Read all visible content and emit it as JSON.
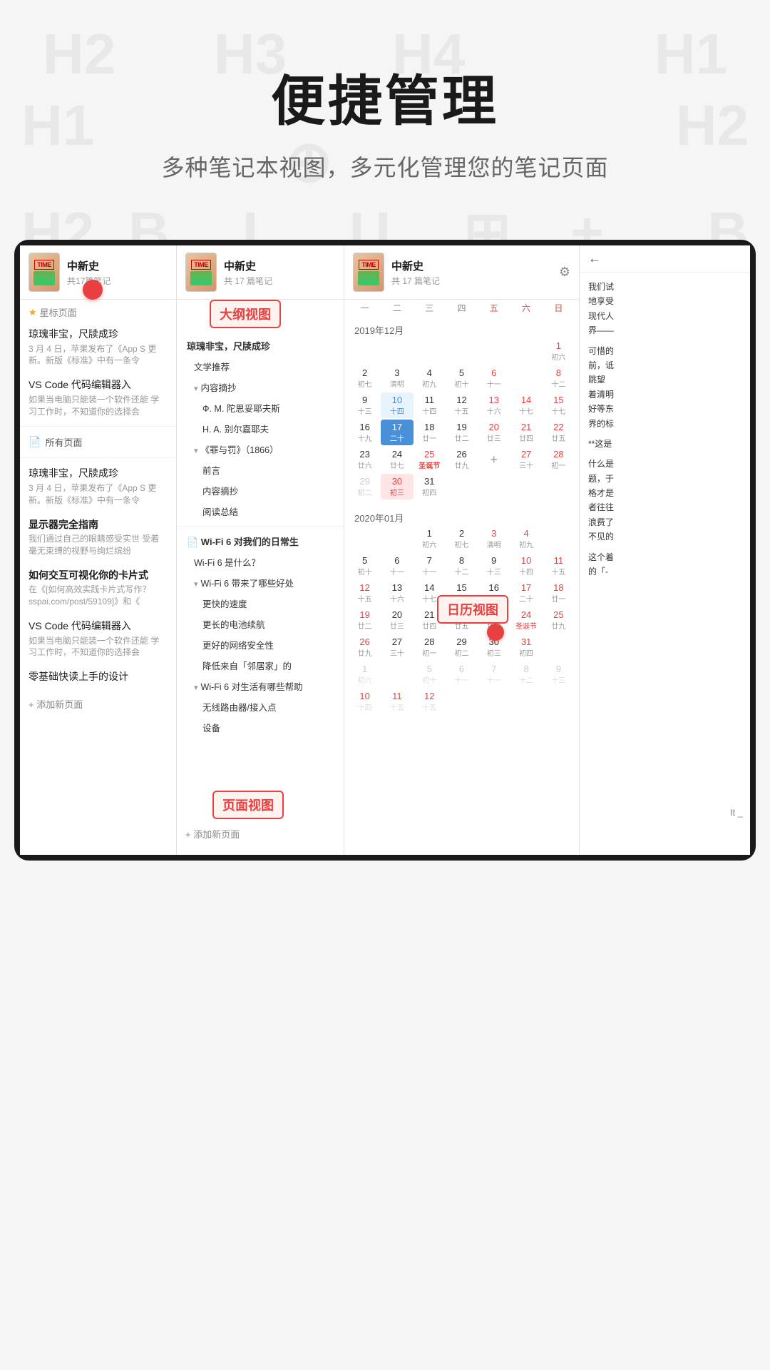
{
  "header": {
    "title": "便捷管理",
    "subtitle": "多种笔记本视图，多元化管理您的笔记页面"
  },
  "notebook": {
    "name": "中新史",
    "count": "共 17 篇笔记",
    "count2": "共17篇笔记",
    "count3": "共 17 篇笔记"
  },
  "left_panel": {
    "starred_label": "星标页面",
    "items": [
      {
        "title": "琼瑰非宝，尺牍成珍",
        "preview": "3 月 4 日，苹果发布了《App S 更新。新版《标准》中有一条令"
      },
      {
        "title": "VS Code 代码编辑器入",
        "preview": "如果当电脑只能装一个软件还能 学习工作时，不知道你的选择会"
      }
    ],
    "all_pages": "所有页面",
    "items2": [
      {
        "title": "琼瑰非宝，尺牍成珍",
        "preview": "3 月 4 日，苹果发布了《App S 更新。新版《标准》中有一条令"
      },
      {
        "title": "显示器完全指南",
        "preview": "我们通过自己的眼睛感受实世 受着毫无束缚的视野与绚烂缤纷"
      },
      {
        "title": "如何交互可视化你的卡片式",
        "preview": "在《[如何高效实践卡片式写作？ sspai.com/post/59109]》和《"
      },
      {
        "title": "VS Code 代码编辑器入",
        "preview": "如果当电脑只能装一个软件还能 学习工作时，不知道你的选择会"
      },
      {
        "title": "零基础快读上手的设计"
      }
    ],
    "add_page": "+ 添加新页面"
  },
  "middle_panel": {
    "label": "大纲视图",
    "starred_item": "琼瑰非宝，尺牍成珍",
    "items": [
      "文学推荐",
      "前言",
      "内容摘抄",
      "Ф. М. 陀思妥耶夫斯",
      "H. A. 别尔嘉耶夫",
      "《罪与罚》（1866）",
      "前言",
      "内容摘抄",
      "阅读总结"
    ],
    "second_item": "Wi-Fi 6 对我们的日常生",
    "wifi_items": [
      "Wi-Fi 6 是什么？",
      "Wi-Fi 6 带来了哪些好处",
      "更快的速度",
      "更长的电池续航",
      "更好的网络安全性",
      "降低来自「邻居家」的",
      "Wi-Fi 6 对生活有哪些帮助",
      "无线路由器/接入点",
      "设备"
    ],
    "add_page": "+ 添加新页面",
    "page_label": "页面视图"
  },
  "calendar_panel": {
    "label": "日历视图",
    "nav_days": [
      "一",
      "二",
      "三",
      "四",
      "五",
      "六",
      "日"
    ],
    "month1": "2019年12月",
    "month2": "2020年01月",
    "dec_days": [
      {
        "num": "1",
        "cn": "初六"
      },
      {
        "num": "2",
        "cn": "初七"
      },
      {
        "num": "3",
        "cn": "清明"
      },
      {
        "num": "4",
        "cn": "初九"
      },
      {
        "num": "5",
        "cn": "初十"
      },
      {
        "num": "6",
        "cn": "十一"
      },
      {
        "num": "8",
        "cn": "十二"
      },
      {
        "num": "9",
        "cn": "十三",
        "selected": true
      },
      {
        "num": "10",
        "cn": "十四",
        "today": true
      },
      {
        "num": "11",
        "cn": "十四"
      },
      {
        "num": "12",
        "cn": "十五"
      },
      {
        "num": "13",
        "cn": "十六"
      },
      {
        "num": "14",
        "cn": "十七"
      },
      {
        "num": "15",
        "cn": "十七"
      },
      {
        "num": "16",
        "cn": "十九"
      },
      {
        "num": "17",
        "cn": "二十",
        "highlight": true
      },
      {
        "num": "18",
        "cn": "廿一"
      },
      {
        "num": "19",
        "cn": "廿二"
      },
      {
        "num": "20",
        "cn": "廿三"
      },
      {
        "num": "21",
        "cn": "廿四"
      },
      {
        "num": "22",
        "cn": "廿五"
      },
      {
        "num": "23",
        "cn": "廿六"
      },
      {
        "num": "25",
        "cn": "圣诞节"
      },
      {
        "num": "26",
        "cn": "廿九"
      },
      {
        "num": "27",
        "cn": "三十"
      },
      {
        "num": "28",
        "cn": "初一"
      },
      {
        "num": "30",
        "cn": "初三",
        "highlight2": true
      },
      {
        "num": "31",
        "cn": "初四"
      }
    ]
  },
  "right_panel": {
    "texts": [
      "我们试 地享受 现代人 界——",
      "可惜的 前，诋 跳望 着清明 好等东 界的标",
      "**这是",
      "什么是 题，于 格才是 者往往 浪费了 不见的",
      "这个着 的「-"
    ]
  },
  "annotations": {
    "outline_label": "大纲视图",
    "calendar_label": "日历视图",
    "page_label": "页面视图"
  },
  "watermark_chars": [
    "H2",
    "H3",
    "H4",
    "H1",
    "H2",
    "B",
    "I",
    "U",
    "⊞",
    "+",
    "B"
  ],
  "it_text": "It _"
}
